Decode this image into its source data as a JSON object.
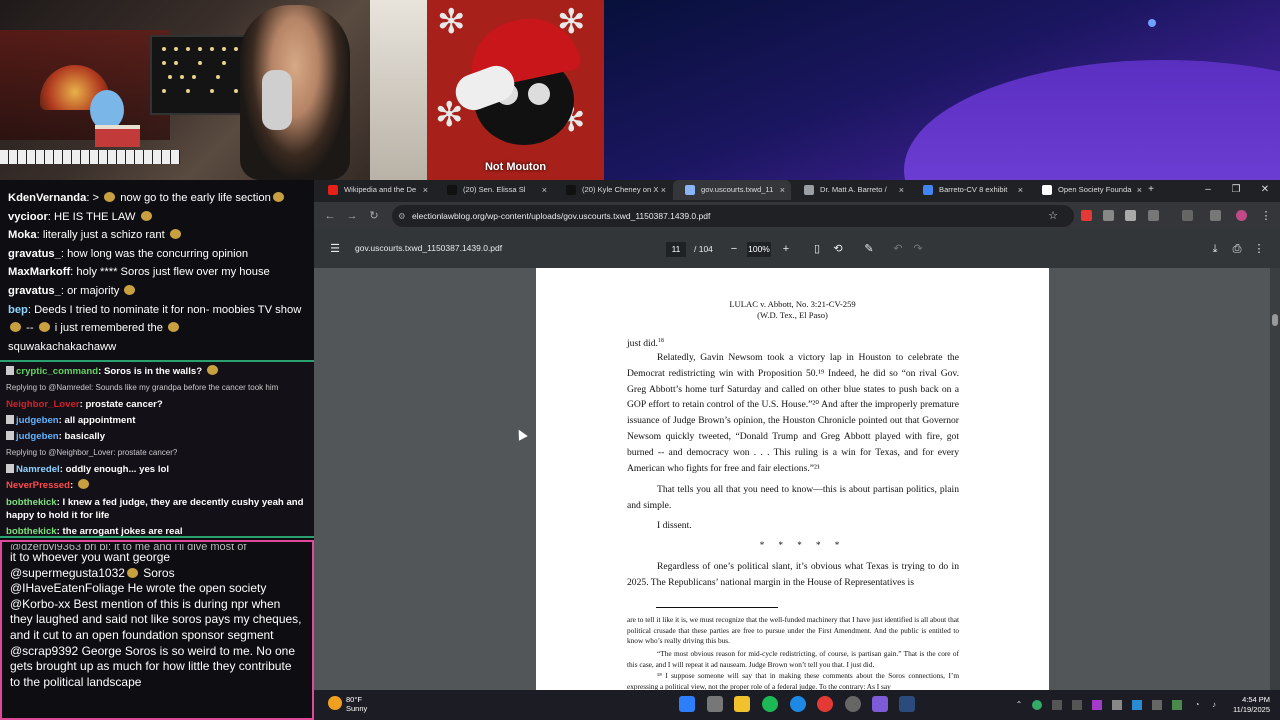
{
  "stream": {
    "avatar_label": "Not Mouton"
  },
  "chat": {
    "top": [
      {
        "user": "KdenVernanda",
        "text": ": > ",
        "text2": " now go to the early life section",
        "user_color": "#ffffff"
      },
      {
        "user": "vycioor",
        "text": ": HE IS THE LAW ",
        "user_color": "#ffffff"
      },
      {
        "user": "Moka",
        "text": ": literally just a schizo rant ",
        "user_color": "#ffffff"
      },
      {
        "user": "gravatus_",
        "text": ": how long was the concurring opinion",
        "user_color": "#ffffff"
      },
      {
        "user": "MaxMarkoff",
        "text": ": holy **** Soros just flew over my house",
        "user_color": "#ffffff"
      },
      {
        "user": "gravatus_",
        "text": ": or majority ",
        "user_color": "#ffffff"
      },
      {
        "user": "bep",
        "text": ": Deeds I tried to nominate it for non- moobies TV show ",
        "text2": " -- ",
        "text3": " i just remembered the ",
        "user_color": "#8fd3ff"
      },
      {
        "user": "",
        "text": "squwakachakachaww",
        "user_color": "#ffffff"
      }
    ],
    "middle": [
      {
        "user": "cryptic_command",
        "text": ": Soros is in the walls? ",
        "user_color": "#5fd35f",
        "badge": true
      },
      {
        "reply": "Replying to @Namredel: Sounds like my grandpa before the cancer took him"
      },
      {
        "user": "Neighbor_Lover",
        "text": ": prostate cancer?",
        "user_color": "#d0202a"
      },
      {
        "user": "judgeben",
        "text": ": all appointment",
        "user_color": "#5fb3ff",
        "badge": true
      },
      {
        "user": "judgeben",
        "text": ": basically",
        "user_color": "#5fb3ff",
        "badge": true
      },
      {
        "reply": "Replying to @Neighbor_Lover: prostate cancer?"
      },
      {
        "user": "Namredel",
        "text": ": oddly enough... yes lol",
        "user_color": "#8fd3ff",
        "badge": true
      },
      {
        "user": "NeverPressed",
        "text": ": ",
        "user_color": "#ff4a4a"
      },
      {
        "user": "bobthekick",
        "text": ": I knew a fed judge, they are decently cushy yeah and happy to hold it for life",
        "user_color": "#7ee07e"
      },
      {
        "user": "bobthekick",
        "text": ": the arrogant jokes are real",
        "user_color": "#7ee07e"
      }
    ],
    "bottom": [
      {
        "user": "",
        "text": "it to whoever you want george"
      },
      {
        "user": "@supermegusta1032",
        "text": " Soros"
      },
      {
        "user": "@IHaveEatenFoliage",
        "text": " He wrote the open society"
      },
      {
        "user": "@Korbo-xx",
        "text": " Best mention of this is during npr when they laughed and said not like soros pays my cheques, and it cut to an open foundation sponsor segment"
      },
      {
        "user": "@scrap9392",
        "text": " George Soros is so weird to me. No one gets brought up as much for how little they contribute to the political landscape"
      }
    ],
    "bottom_cut": "@dzerbyl9363 bri bi: it to me and i'll give most of"
  },
  "browser": {
    "tabs": [
      {
        "label": "Wikipedia and the De",
        "color": "#e62117"
      },
      {
        "label": "(20) Sen. Elissa Sl",
        "color": "#111111"
      },
      {
        "label": "(20) Kyle Cheney on X",
        "color": "#111111"
      },
      {
        "label": "gov.uscourts.txwd_11",
        "color": "#8ab4f8"
      },
      {
        "label": "Dr. Matt A. Barreto / ",
        "color": "#9aa0a6"
      },
      {
        "label": "Barreto-CV 8 exhibit",
        "color": "#4285f4"
      },
      {
        "label": "Open Society Founda",
        "color": "#ffffff"
      }
    ],
    "url": "electionlawblog.org/wp-content/uploads/gov.uscourts.txwd_1150387.1439.0.pdf"
  },
  "pdf": {
    "filename": "gov.uscourts.txwd_1150387.1439.0.pdf",
    "page": "11",
    "total": "/ 104",
    "zoom": "100%",
    "header1": "LULAC v. Abbott, No. 3:21-CV-259",
    "header2": "(W.D. Tex., El Paso)",
    "p1": "just did.",
    "p1_sup": "18",
    "p2": "Relatedly, Gavin Newsom took a victory lap in Houston to celebrate the Democrat redistricting win with Proposition 50.¹⁹ Indeed, he did so “on rival Gov. Greg Abbott’s home turf Saturday and called on other blue states to push back on a GOP effort to retain control of the U.S. House.”²⁰ And after the improperly premature issuance of Judge Brown’s opinion, the Houston Chronicle pointed out that Governor Newsom quickly tweeted, “Donald Trump and Greg Abbott played with fire, got burned -- and democracy won . . . This ruling is a win for Texas, and for every American who fights for free and fair elections.”²¹",
    "p3": "That tells you all that you need to know—this is about partisan politics, plain and simple.",
    "p4": "I dissent.",
    "stars": "* * * * *",
    "p5": "Regardless of one’s political slant, it’s obvious what Texas is trying to do in 2025. The Republicans’ national margin in the House of Representatives is",
    "fn1": "are to tell it like it is, we must recognize that the well-funded machinery that I have just identified is all about that political crusade that these parties are free to pursue under the First Amendment. And the public is entitled to know who’s really driving this bus.",
    "fn2": "“The most obvious reason for mid-cycle redistricting, of course, is partisan gain.” That is the core of this case, and I will repeat it ad nauseam. Judge Brown won’t tell you that. I just did.",
    "fn3": "¹⁸ I suppose someone will say that in making these comments about the Soros connections, I’m expressing a political view, not the proper role of a federal judge. To the contrary: As I say"
  },
  "taskbar": {
    "temp": "80°F",
    "condition": "Sunny",
    "time": "4:54 PM",
    "date": "11/19/2025"
  }
}
